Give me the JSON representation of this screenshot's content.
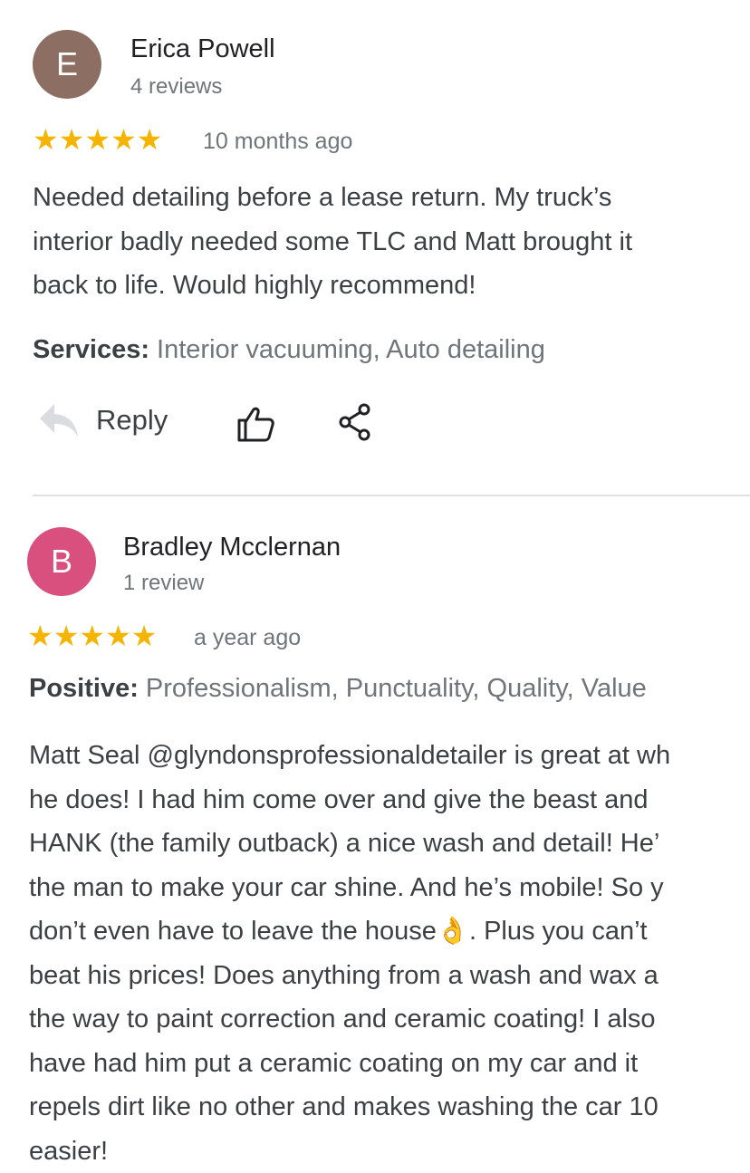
{
  "reviews": [
    {
      "avatar_letter": "E",
      "avatar_color": "#8d6e63",
      "name": "Erica Powell",
      "review_count": "4 reviews",
      "rating": 5,
      "stars": "★★★★★",
      "date": "10 months ago",
      "text_lines": [
        "Needed detailing before a lease return. My truck’s",
        "interior badly needed some TLC and Matt brought it",
        "back to life. Would highly recommend!"
      ],
      "meta_label": "Services:",
      "meta_value": " Interior vacuuming, Auto detailing",
      "actions": {
        "reply_label": "Reply",
        "like_icon": "thumbs-up-icon",
        "share_icon": "share-icon"
      }
    },
    {
      "avatar_letter": "B",
      "avatar_color": "#d94f7d",
      "name": "Bradley Mcclernan",
      "review_count": "1 review",
      "rating": 5,
      "stars": "★★★★★",
      "date": "a year ago",
      "meta_label": "Positive:",
      "meta_value": " Professionalism, Punctuality, Quality, Value",
      "text_lines": [
        "Matt Seal @glyndonsprofessionaldetailer is great at wh",
        "he does! I had him come over and give the beast and",
        "HANK (the family outback) a nice wash and detail! He’",
        "the man to make your car shine. And he’s mobile! So y",
        "don’t even have to leave the house👌. Plus you can’t",
        "beat his prices! Does anything from a wash and wax a",
        "the way to paint correction and ceramic coating! I also",
        "have had him put a ceramic coating on my car and it",
        "repels dirt like no other and makes washing the car 10",
        "easier!"
      ]
    }
  ],
  "colors": {
    "star": "#f4b400",
    "muted_text": "#70757a",
    "body_text": "#3c4043"
  }
}
